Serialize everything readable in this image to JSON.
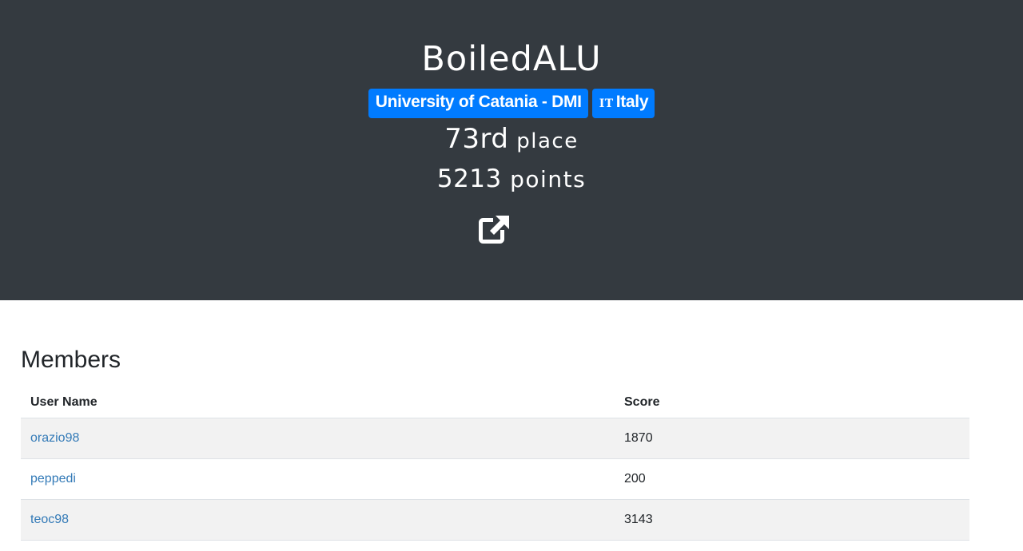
{
  "team": {
    "name": "BoiledALU",
    "affiliation": "University of Catania - DMI",
    "country_code": "IT",
    "country": "Italy",
    "place_number": "73rd",
    "place_label": "place",
    "points_number": "5213",
    "points_label": "points",
    "external_link_icon": "external-link-icon"
  },
  "colors": {
    "hero_bg": "#343a40",
    "badge": "#007bff",
    "link": "#337ab7",
    "stripe": "#f2f2f2"
  },
  "members": {
    "title": "Members",
    "columns": [
      "User Name",
      "Score"
    ],
    "rows": [
      {
        "user": "orazio98",
        "score": "1870"
      },
      {
        "user": "peppedi",
        "score": "200"
      },
      {
        "user": "teoc98",
        "score": "3143"
      }
    ]
  }
}
